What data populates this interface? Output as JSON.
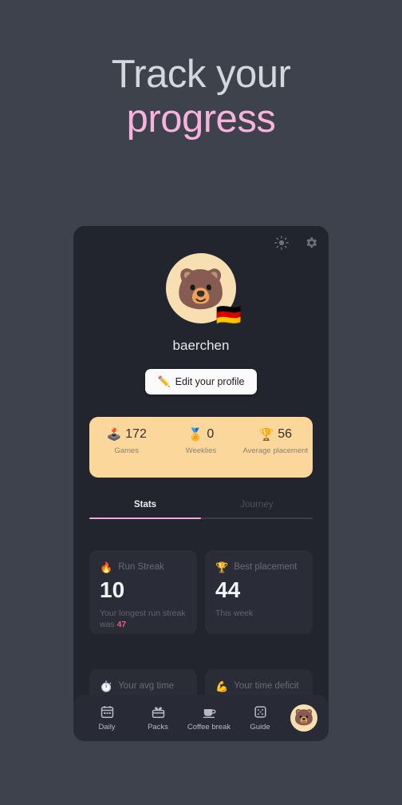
{
  "hero": {
    "line1": "Track your",
    "line2": "progress",
    "line1_color": "#d4d7dd",
    "line2_color": "#f7b3dd"
  },
  "theme": {
    "page_bg": "#3e424d",
    "card_bg": "#22242e",
    "inner_card_bg": "#2a2c38",
    "accent_pink": "#f0a7e0",
    "accent_peach": "#fbd79b",
    "accent_red": "#ef5f6b",
    "avatar_bg": "#f8dfb2"
  },
  "header": {
    "light_mode_icon": "sun-icon",
    "settings_icon": "gear-icon"
  },
  "profile": {
    "avatar_emoji": "🐻",
    "flag_emoji": "🇩🇪",
    "username": "baerchen",
    "edit_button": {
      "icon": "✏️",
      "label": "Edit your profile"
    }
  },
  "summary_stats": [
    {
      "icon": "🕹️",
      "icon_name": "joystick-icon",
      "value": "172",
      "label": "Games"
    },
    {
      "icon": "🏅",
      "icon_name": "medal-icon",
      "value": "0",
      "label": "Weeklies"
    },
    {
      "icon": "🏆",
      "icon_name": "trophy-icon",
      "value": "56",
      "label": "Average placement"
    }
  ],
  "tabs": [
    {
      "label": "Stats",
      "active": true
    },
    {
      "label": "Journey",
      "active": false
    }
  ],
  "stat_cards": [
    {
      "icon": "🔥",
      "icon_name": "fire-icon",
      "title": "Run Streak",
      "value": "10",
      "sub_prefix": "Your longest run streak was ",
      "sub_highlight": "47"
    },
    {
      "icon": "🏆",
      "icon_name": "trophy-icon",
      "title": "Best placement",
      "value": "44",
      "sub_prefix": "This week",
      "sub_highlight": ""
    }
  ],
  "stat_cards_row2": [
    {
      "icon": "⏱️",
      "icon_name": "stopwatch-icon",
      "title": "Your avg time"
    },
    {
      "icon": "💪",
      "icon_name": "bicep-icon",
      "title": "Your time deficit"
    }
  ],
  "bottom_nav": {
    "items": [
      {
        "label": "Daily",
        "icon_name": "calendar-icon"
      },
      {
        "label": "Packs",
        "icon_name": "gift-box-icon"
      },
      {
        "label": "Coffee break",
        "icon_name": "coffee-cup-icon"
      },
      {
        "label": "Guide",
        "icon_name": "dice-icon"
      }
    ],
    "avatar_emoji": "🐻"
  }
}
